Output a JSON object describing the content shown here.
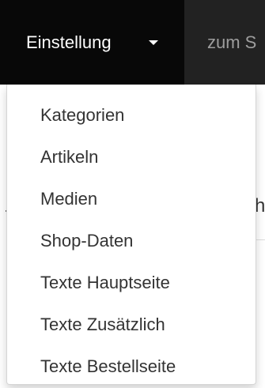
{
  "navbar": {
    "active_menu_label": "Einstellung",
    "next_link_label": "zum S",
    "colors": {
      "background": "#222222",
      "active_background": "#080808",
      "active_text": "#ffffff",
      "link_text": "#9d9d9d"
    }
  },
  "dropdown": {
    "items": [
      {
        "label": "Kategorien"
      },
      {
        "label": "Artikeln"
      },
      {
        "label": "Medien"
      },
      {
        "label": "Shop-Daten"
      },
      {
        "label": "Texte Hauptseite"
      },
      {
        "label": "Texte Zusätzlich"
      },
      {
        "label": "Texte Bestellseite"
      }
    ]
  },
  "background": {
    "partial_text": "h"
  }
}
